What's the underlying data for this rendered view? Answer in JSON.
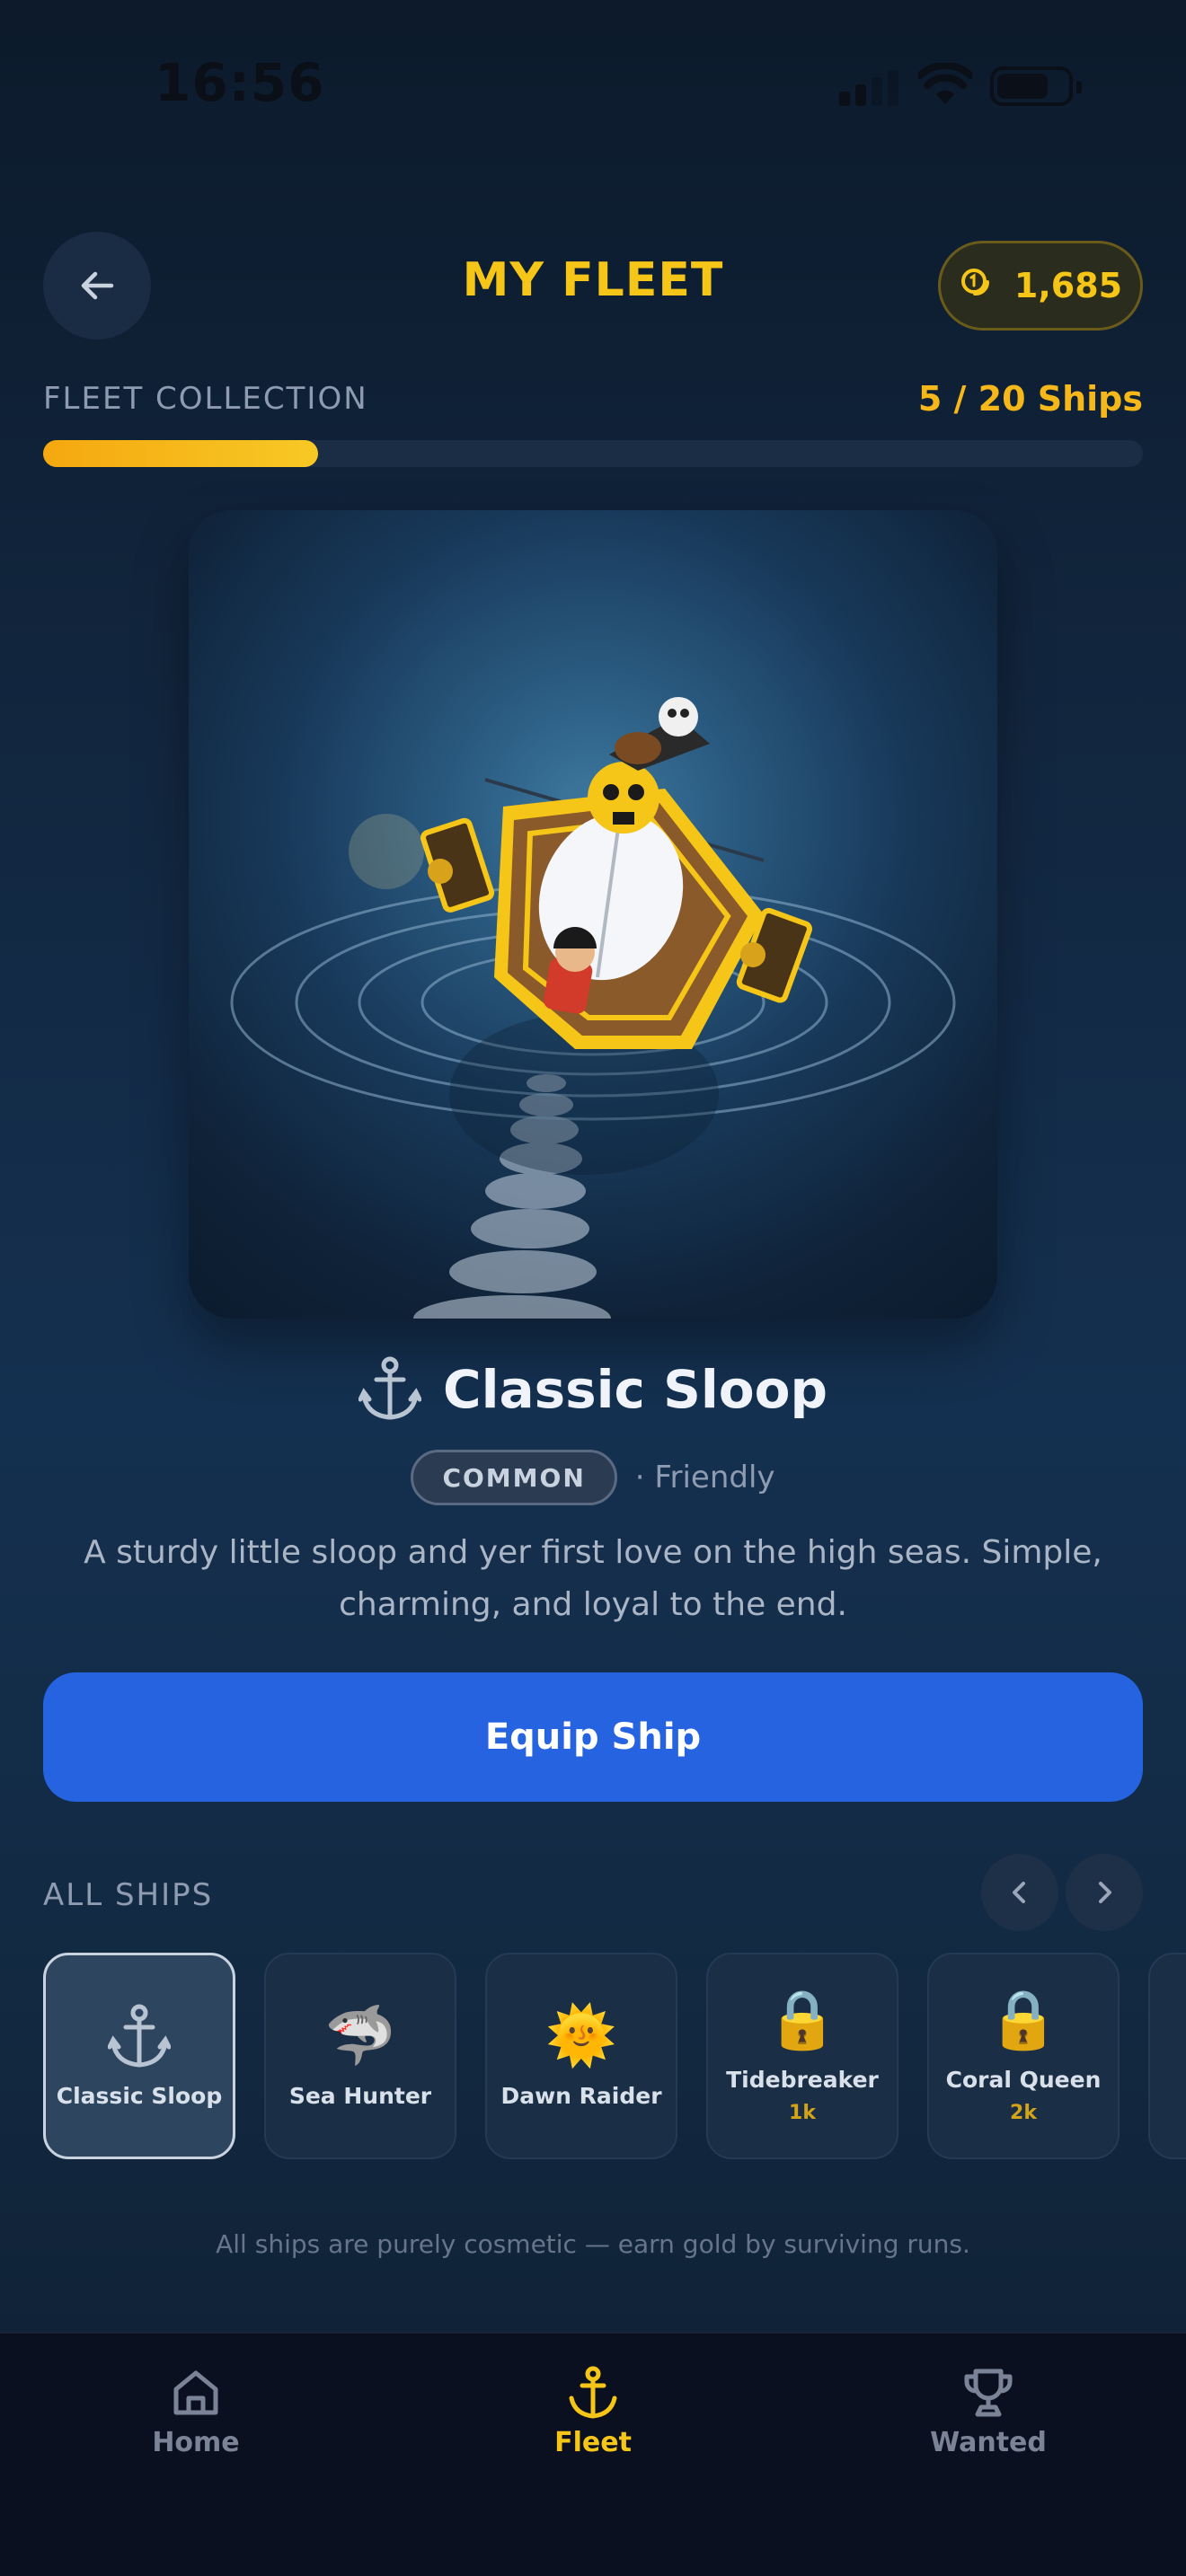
{
  "status_bar": {
    "time": "16:56"
  },
  "header": {
    "title": "MY FLEET",
    "coins": "1,685"
  },
  "collection": {
    "label": "FLEET COLLECTION",
    "count": "5 / 20 Ships",
    "progress": 0.25
  },
  "ship": {
    "name": "Classic Sloop",
    "icon": "anchor-icon",
    "rarity": "COMMON",
    "temperament": "· Friendly",
    "description": "A sturdy little sloop and yer first love on the high seas. Simple, charming, and loyal to the end."
  },
  "actions": {
    "equip_label": "Equip Ship"
  },
  "all_ships": {
    "label": "ALL SHIPS",
    "items": [
      {
        "label": "Classic Sloop",
        "icon": "⚓",
        "icon_name": "anchor-icon",
        "selected": true,
        "price": ""
      },
      {
        "label": "Sea Hunter",
        "icon": "🦈",
        "icon_name": "shark-icon",
        "selected": false,
        "price": ""
      },
      {
        "label": "Dawn Raider",
        "icon": "🌞",
        "icon_name": "sun-icon",
        "selected": false,
        "price": ""
      },
      {
        "label": "Tidebreaker",
        "icon": "🔒",
        "icon_name": "lock-icon",
        "selected": false,
        "price": "1k"
      },
      {
        "label": "Coral Queen",
        "icon": "🔒",
        "icon_name": "lock-icon",
        "selected": false,
        "price": "2k"
      }
    ]
  },
  "footer_note": "All ships are purely cosmetic — earn gold by surviving runs.",
  "bottom_nav": {
    "items": [
      {
        "label": "Home",
        "icon": "home-icon",
        "active": false
      },
      {
        "label": "Fleet",
        "icon": "anchor-icon",
        "active": true
      },
      {
        "label": "Wanted",
        "icon": "trophy-icon",
        "active": false
      }
    ]
  },
  "colors": {
    "accent_gold": "#f5c518",
    "primary_blue": "#2563e0",
    "background": "#122740"
  }
}
